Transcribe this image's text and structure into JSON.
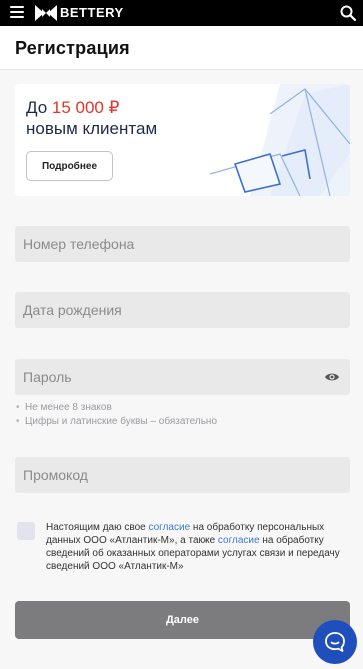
{
  "topbar": {
    "logo_text": "BETTERY",
    "icons": [
      "menu-icon",
      "logo-icon",
      "search-icon"
    ]
  },
  "header": {
    "title": "Регистрация"
  },
  "banner": {
    "prefix": "До ",
    "amount": "15 000 ₽",
    "line2": "новым клиентам",
    "button_label": "Подробнее",
    "amount_color": "#e8332a",
    "text_color": "#1e2a4a"
  },
  "form": {
    "phone": {
      "placeholder": "Номер телефона",
      "value": ""
    },
    "birthdate": {
      "placeholder": "Дата рождения",
      "value": ""
    },
    "password": {
      "placeholder": "Пароль",
      "value": ""
    },
    "password_hints": [
      "Не менее 8 знаков",
      "Цифры и латинские буквы – обязательно"
    ],
    "promo": {
      "placeholder": "Промокод",
      "value": ""
    }
  },
  "consent": {
    "part1": "Настоящим даю свое ",
    "link1": "согласие",
    "part2": " на обработку персональных данных ООО «Атлантик-М», а также ",
    "link2": "согласие",
    "part3": " на обработку сведений об оказанных операторами услугах связи и передачу сведений ООО «Атлантик-М»",
    "checked": false,
    "link_color": "#3b7bd1"
  },
  "submit": {
    "label": "Далее",
    "color": "#7c7c7e"
  },
  "chat": {
    "icon": "chat-icon",
    "color": "#1f4fbd"
  }
}
